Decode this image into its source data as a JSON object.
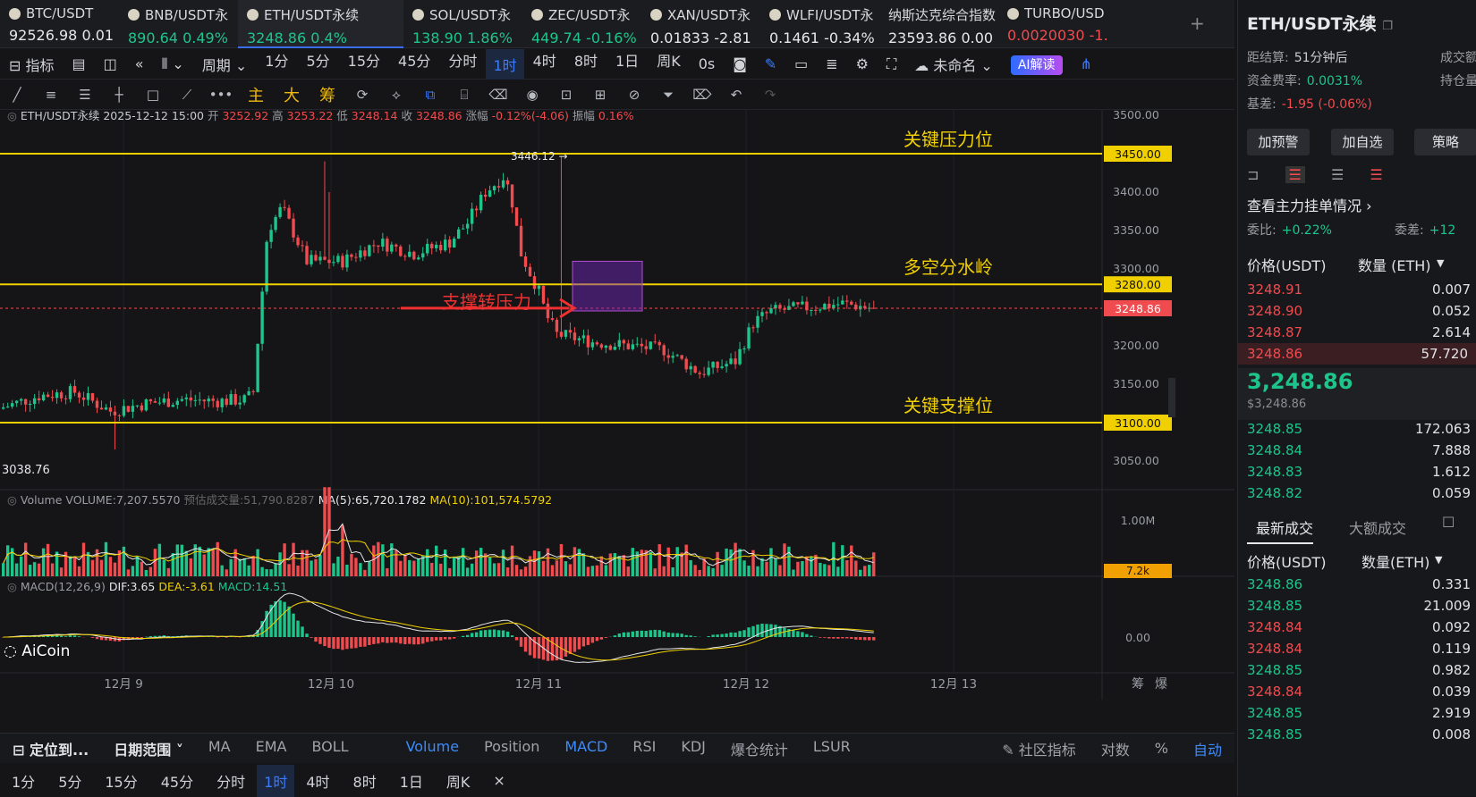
{
  "tickers": [
    {
      "symbol": "BTC/USDT",
      "price": "92526.98",
      "change": "0.01",
      "dir": "wh",
      "active": false
    },
    {
      "symbol": "BNB/USDT永",
      "price": "890.64",
      "change": "0.49%",
      "dir": "up",
      "active": false
    },
    {
      "symbol": "ETH/USDT永续",
      "price": "3248.86",
      "change": "0.4%",
      "dir": "up",
      "active": true
    },
    {
      "symbol": "SOL/USDT永",
      "price": "138.90",
      "change": "1.86%",
      "dir": "up",
      "active": false
    },
    {
      "symbol": "ZEC/USDT永",
      "price": "449.74",
      "change": "-0.16%",
      "dir": "up",
      "active": false
    },
    {
      "symbol": "XAN/USDT永",
      "price": "0.01833",
      "change": "-2.81",
      "dir": "wh",
      "active": false
    },
    {
      "symbol": "WLFI/USDT永",
      "price": "0.1461",
      "change": "-0.34%",
      "dir": "wh",
      "active": false
    },
    {
      "symbol": "纳斯达克综合指数",
      "price": "23593.86",
      "change": "0.00",
      "dir": "wh",
      "active": false
    },
    {
      "symbol": "TURBO/USD",
      "price": "0.0020030",
      "change": "-1.",
      "dir": "dn",
      "active": false
    }
  ],
  "toolbar1": {
    "indicator": "指标",
    "period": "周期",
    "intervals": [
      "1分",
      "5分",
      "15分",
      "45分",
      "分时",
      "1时",
      "4时",
      "8时",
      "1日",
      "周K"
    ],
    "selected": "1时",
    "countdown": "0s",
    "layout_name": "未命名",
    "ai": "AI解读"
  },
  "toolbar2": {
    "main": "主",
    "big": "大",
    "chip": "筹"
  },
  "chart_info": {
    "symbol": "ETH/USDT永续",
    "datetime": "2025-12-12 15:00",
    "open_label": "开",
    "open": "3252.92",
    "high_label": "高",
    "high": "3253.22",
    "low_label": "低",
    "low": "3248.14",
    "close_label": "收",
    "close": "3248.86",
    "chg_label": "涨幅",
    "chg": "-0.12%(-4.06)",
    "amp_label": "振幅",
    "amp": "0.16%"
  },
  "annotations": {
    "resistance": "关键压力位",
    "pivot": "多空分水岭",
    "support": "关键支撑位",
    "arrow_text": "支撑转压力",
    "high_mark": "3446.12 →",
    "low_mark": "3038.76"
  },
  "price_axis": [
    "3500.00",
    "3450.00",
    "3400.00",
    "3350.00",
    "3300.00",
    "3280.00",
    "3248.86",
    "3200.00",
    "3150.00",
    "3100.00",
    "3050.00"
  ],
  "volume_info": {
    "label": "Volume",
    "vol": "VOLUME:7,207.5570",
    "pred": "预估成交量:51,790.8287",
    "ma5": "MA(5):65,720.1782",
    "ma10": "MA(10):101,574.5792",
    "axis_top": "1.00M",
    "axis_cur": "7.2k"
  },
  "macd_info": {
    "label": "MACD(12,26,9)",
    "dif": "DIF:3.65",
    "dea": "DEA:-3.61",
    "macd": "MACD:14.51",
    "axis_zero": "0.00"
  },
  "logo": "AiCoin",
  "date_axis": [
    "12月 9",
    "12月 10",
    "12月 11",
    "12月 12",
    "12月 13"
  ],
  "date_axis_right": [
    "筹",
    "爆"
  ],
  "bottom1": {
    "locate": "定位到...",
    "range": "日期范围",
    "items": [
      "MA",
      "EMA",
      "BOLL",
      "Volume",
      "Position",
      "MACD",
      "RSI",
      "KDJ",
      "爆仓统计",
      "LSUR"
    ],
    "community": "社区指标",
    "log": "对数",
    "pct": "%",
    "auto": "自动"
  },
  "bottom2": {
    "items": [
      "1分",
      "5分",
      "15分",
      "45分",
      "分时",
      "1时",
      "4时",
      "8时",
      "1日",
      "周K"
    ],
    "selected": "1时",
    "close": "×"
  },
  "right": {
    "title": "ETH/USDT永续",
    "settle_label": "距结算:",
    "settle": "51分钟后",
    "vol_label": "成交额",
    "funding_label": "资金费率:",
    "funding": "0.0031%",
    "oi_label": "持仓量",
    "basis_label": "基差:",
    "basis": "-1.95 (-0.06%)",
    "btn_alert": "加预警",
    "btn_fav": "加自选",
    "btn_strategy": "策略",
    "main_orders": "查看主力挂单情况",
    "ratio_label": "委比:",
    "ratio": "+0.22%",
    "diff_label": "委差:",
    "diff": "+12",
    "col_price": "价格(USDT)",
    "col_qty": "数量 (ETH)",
    "asks": [
      {
        "p": "3248.91",
        "q": "0.007"
      },
      {
        "p": "3248.90",
        "q": "0.052"
      },
      {
        "p": "3248.87",
        "q": "2.614"
      },
      {
        "p": "3248.86",
        "q": "57.720"
      }
    ],
    "last": "3,248.86",
    "last_usd": "$3,248.86",
    "bids": [
      {
        "p": "3248.85",
        "q": "172.063"
      },
      {
        "p": "3248.84",
        "q": "7.888"
      },
      {
        "p": "3248.83",
        "q": "1.612"
      },
      {
        "p": "3248.82",
        "q": "0.059"
      }
    ],
    "tab_latest": "最新成交",
    "tab_large": "大额成交",
    "col_price2": "价格(USDT)",
    "col_qty2": "数量(ETH)",
    "trades": [
      {
        "p": "3248.86",
        "q": "0.331",
        "d": "up"
      },
      {
        "p": "3248.85",
        "q": "21.009",
        "d": "up"
      },
      {
        "p": "3248.84",
        "q": "0.092",
        "d": "dn"
      },
      {
        "p": "3248.84",
        "q": "0.119",
        "d": "dn"
      },
      {
        "p": "3248.85",
        "q": "0.982",
        "d": "up"
      },
      {
        "p": "3248.84",
        "q": "0.039",
        "d": "dn"
      },
      {
        "p": "3248.85",
        "q": "2.919",
        "d": "up"
      },
      {
        "p": "3248.85",
        "q": "0.008",
        "d": "up"
      }
    ]
  },
  "colors": {
    "up": "#1ec58b",
    "down": "#f04b4f",
    "level": "#f0d000",
    "accent": "#3b7cff"
  }
}
